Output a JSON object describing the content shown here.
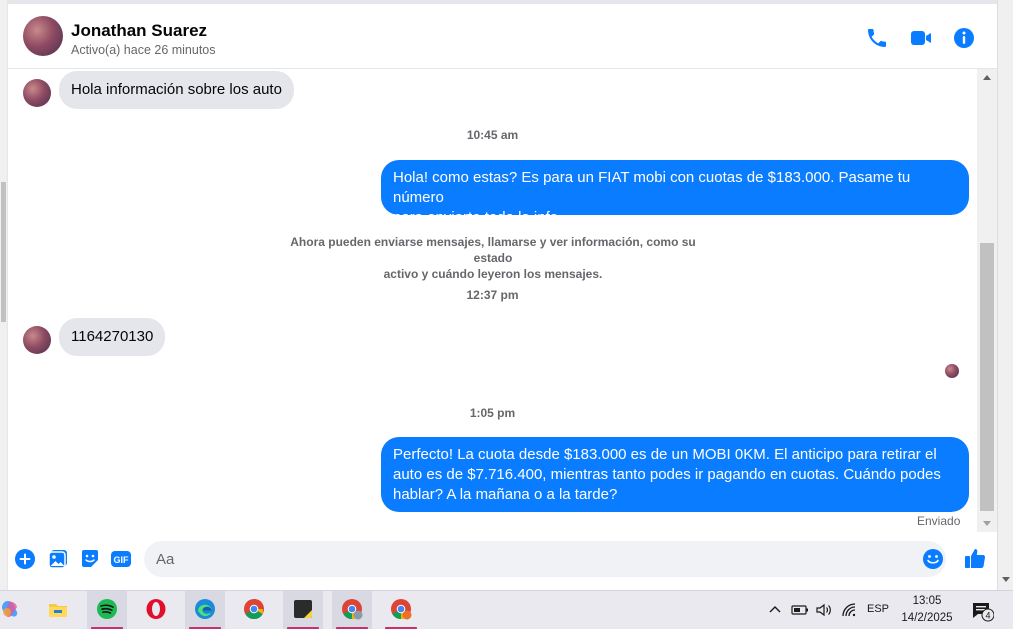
{
  "header": {
    "contact_name": "Jonathan Suarez",
    "status": "Activo(a) hace 26 minutos",
    "icons": [
      "phone-icon",
      "video-icon",
      "info-icon"
    ],
    "accent_color": "#0a7cff"
  },
  "chat": {
    "messages": [
      {
        "direction": "in",
        "text": "Hola información sobre los auto"
      },
      {
        "type": "timestamp",
        "text": "10:45 am"
      },
      {
        "direction": "out",
        "lines": [
          "Hola! como estas? Es para un FIAT mobi con cuotas de $183.000. Pasame tu número",
          "para enviarte toda la info"
        ]
      },
      {
        "type": "system",
        "lines": [
          "Ahora pueden enviarse mensajes, llamarse y ver información, como su estado",
          "activo y cuándo leyeron los mensajes."
        ]
      },
      {
        "type": "timestamp",
        "text": "12:37 pm"
      },
      {
        "direction": "in",
        "text": "1164270130"
      },
      {
        "type": "timestamp",
        "text": "1:05 pm"
      },
      {
        "direction": "out",
        "lines": [
          "Perfecto! La cuota desde $183.000 es de un MOBI 0KM. El anticipo para retirar el",
          "auto es de $7.716.400, mientras tanto podes ir pagando en cuotas. Cuándo podes",
          "hablar? A la mañana o a la tarde?"
        ]
      }
    ],
    "sent_status": "Enviado"
  },
  "composer": {
    "placeholder": "Aa",
    "icons": [
      "plus-icon",
      "image-icon",
      "sticker-icon",
      "gif-icon",
      "emoji-icon",
      "like-icon"
    ],
    "gif_label": "GIF"
  },
  "taskbar": {
    "apps": [
      "copilot-icon",
      "file-explorer-icon",
      "spotify-icon",
      "opera-icon",
      "edge-icon",
      "chrome-icon",
      "sticky-notes-icon",
      "chrome-profile-1-icon",
      "chrome-profile-2-icon"
    ],
    "language": "ESP",
    "time": "13:05",
    "date": "14/2/2025",
    "notifications_count": "4"
  }
}
